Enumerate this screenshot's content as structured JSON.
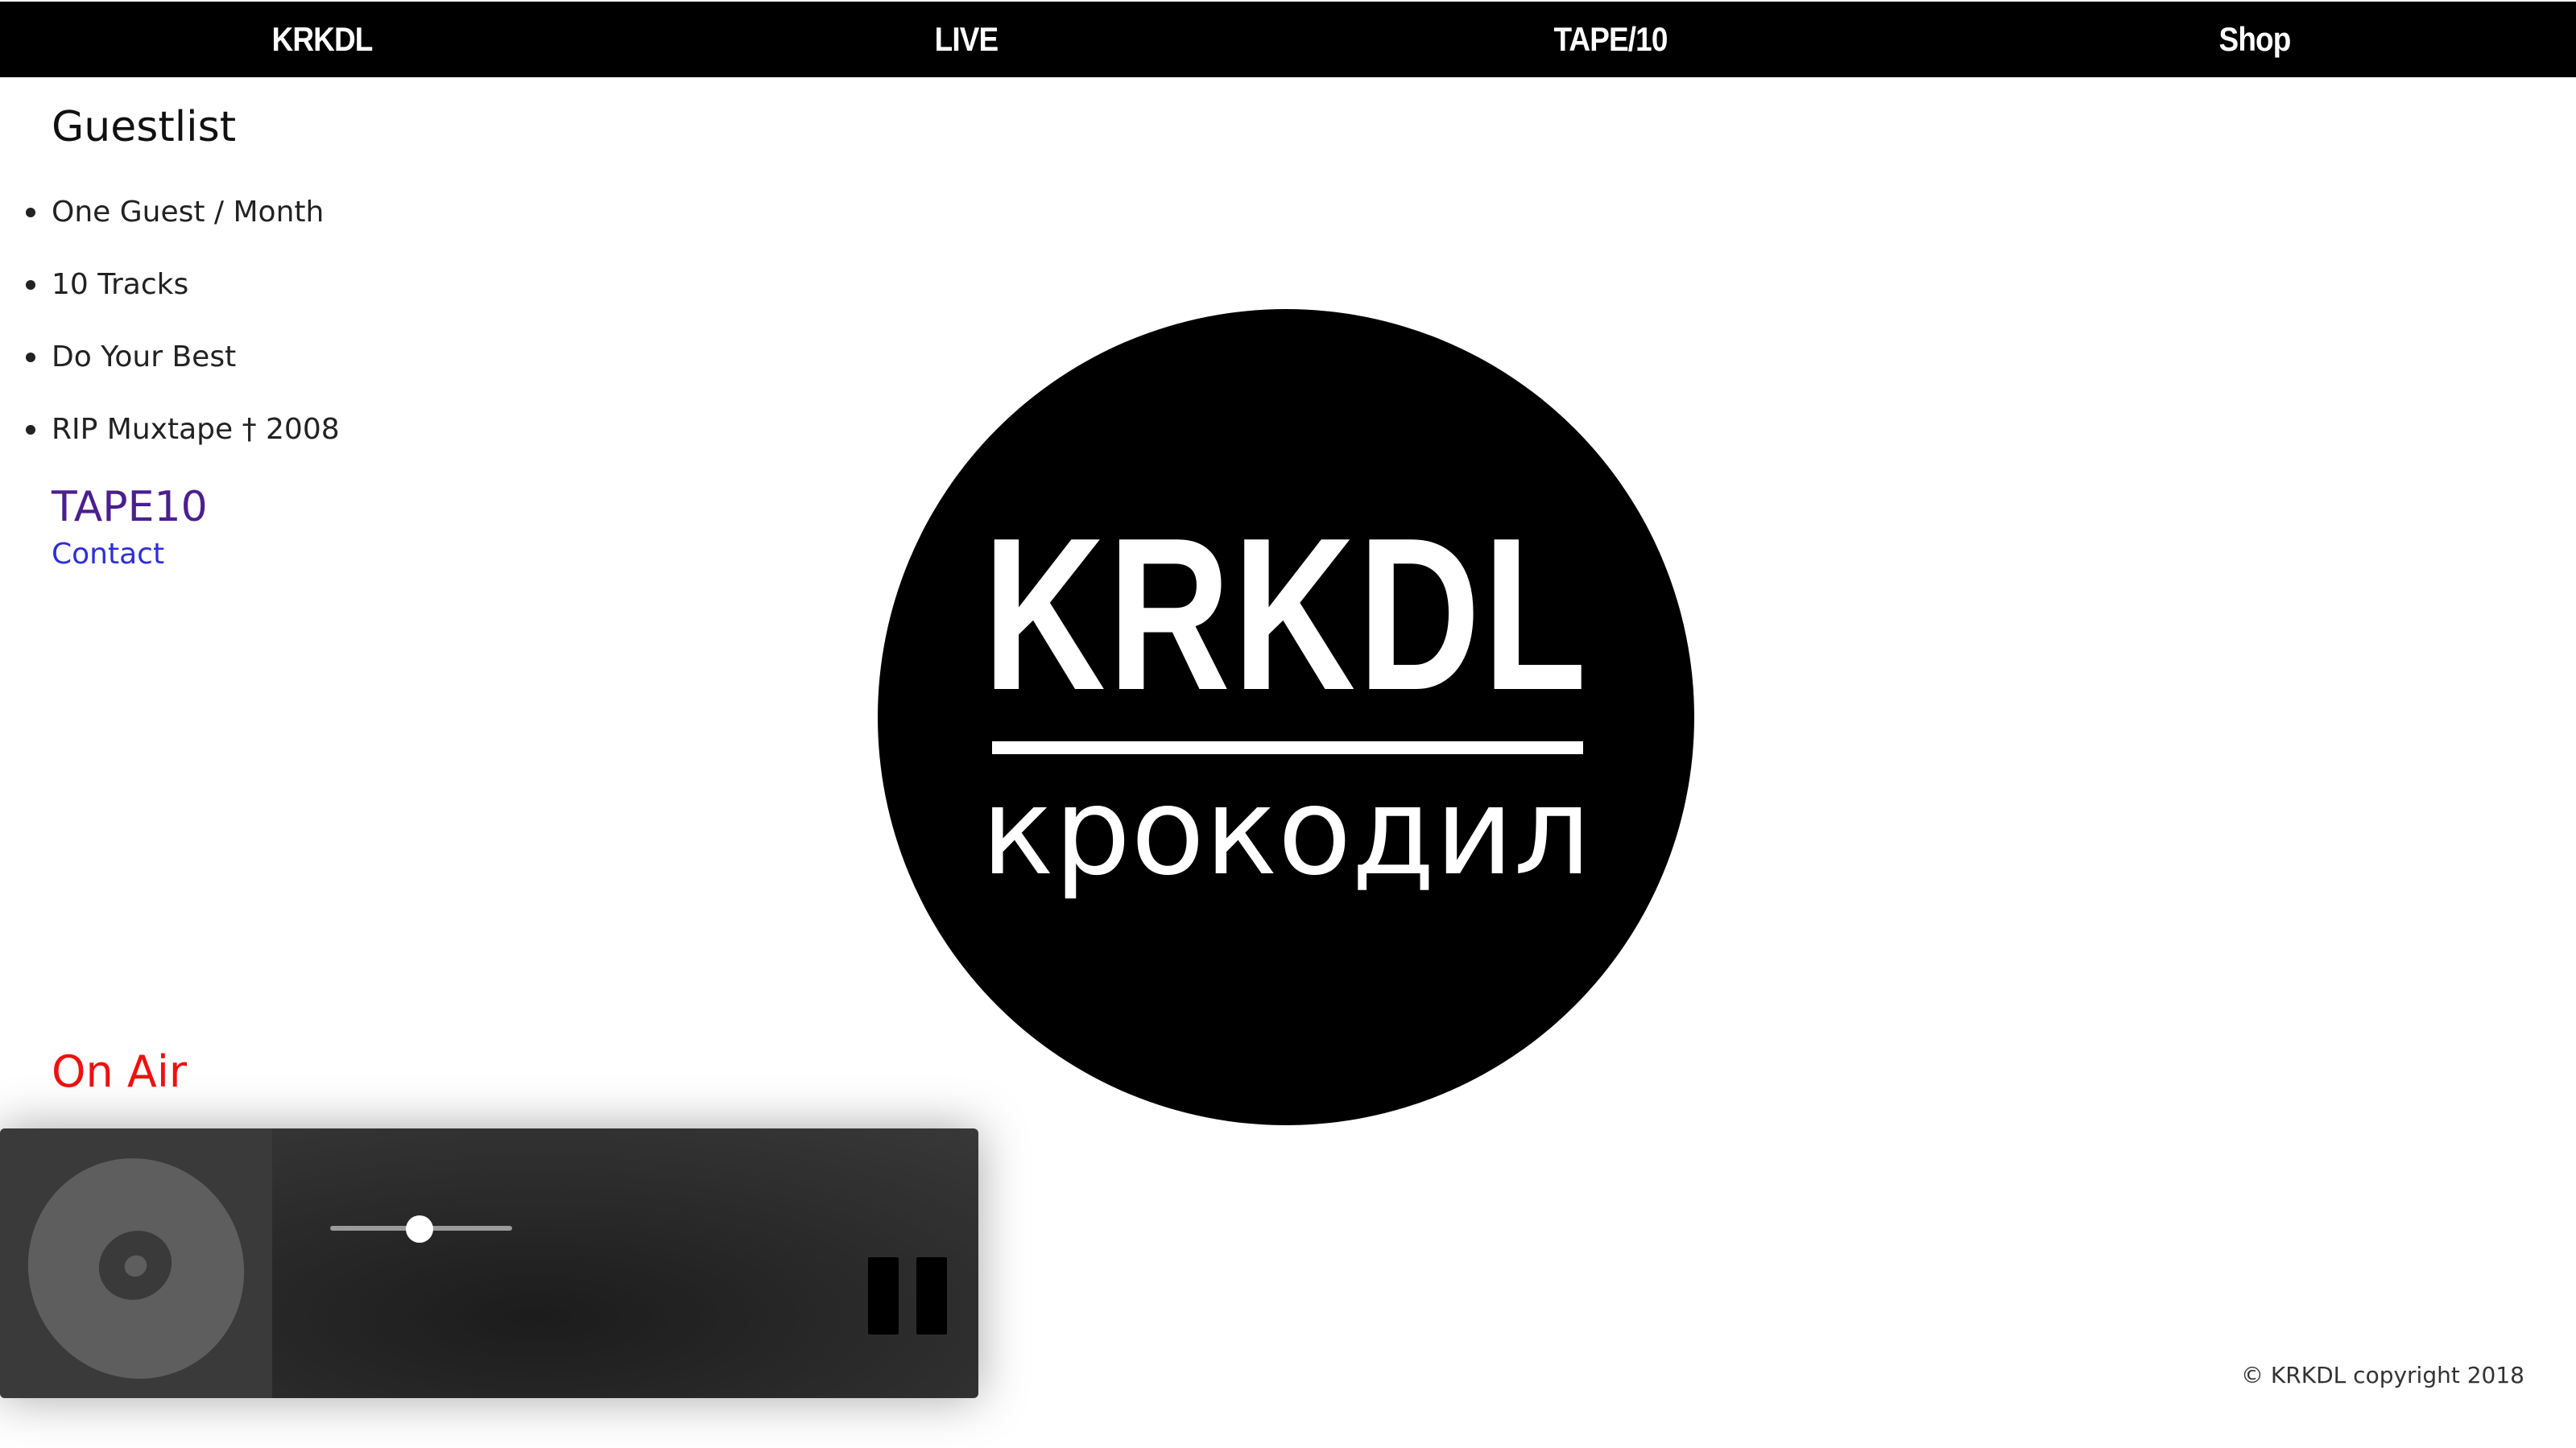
{
  "nav": {
    "items": [
      {
        "label": "KRKDL"
      },
      {
        "label": "LIVE"
      },
      {
        "label": "TAPE/10"
      },
      {
        "label": "Shop"
      }
    ]
  },
  "sidebar": {
    "title": "Guestlist",
    "rules": [
      {
        "text": "One Guest / Month"
      },
      {
        "text": "10 Tracks"
      },
      {
        "text": "Do Your Best"
      },
      {
        "text": "RIP Muxtape † 2008"
      }
    ],
    "tape10_label": "TAPE10",
    "contact_label": "Contact",
    "on_air_label": "On Air"
  },
  "logo": {
    "main_text": "KRKDL",
    "sub_text": "крокодил"
  },
  "player": {
    "artwork_icon": "disc-icon",
    "volume_level": 0.5,
    "state": "playing",
    "control_icon": "pause-icon"
  },
  "footer": {
    "copyright": "© KRKDL copyright 2018"
  },
  "colors": {
    "nav_background": "#000000",
    "tape10_link": "#4b1f8e",
    "contact_link": "#2e2ed6",
    "on_air": "#ee1111"
  }
}
